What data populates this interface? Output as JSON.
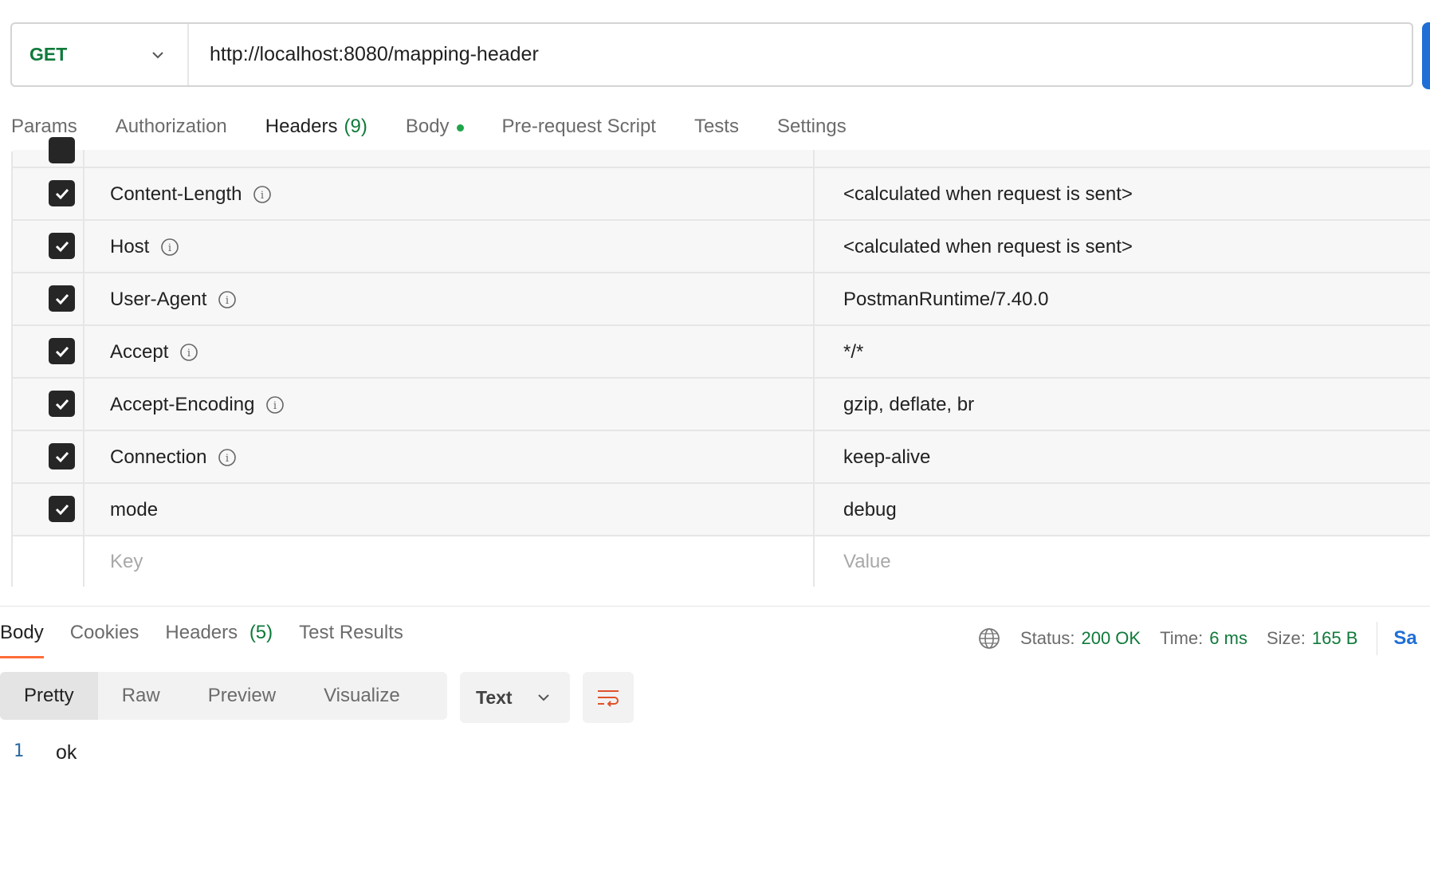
{
  "request": {
    "method": "GET",
    "url": "http://localhost:8080/mapping-header"
  },
  "request_tabs": [
    {
      "label": "Params"
    },
    {
      "label": "Authorization"
    },
    {
      "label": "Headers",
      "count": "(9)"
    },
    {
      "label": "Body"
    },
    {
      "label": "Pre-request Script"
    },
    {
      "label": "Tests"
    },
    {
      "label": "Settings"
    }
  ],
  "headers": [
    {
      "key": "Content-Length",
      "value": "<calculated when request is sent>",
      "checked": true
    },
    {
      "key": "Host",
      "value": "<calculated when request is sent>",
      "checked": true
    },
    {
      "key": "User-Agent",
      "value": "PostmanRuntime/7.40.0",
      "checked": true
    },
    {
      "key": "Accept",
      "value": "*/*",
      "checked": true
    },
    {
      "key": "Accept-Encoding",
      "value": "gzip, deflate, br",
      "checked": true
    },
    {
      "key": "Connection",
      "value": "keep-alive",
      "checked": true
    },
    {
      "key": "mode",
      "value": "debug",
      "checked": true
    }
  ],
  "new_header": {
    "key_placeholder": "Key",
    "value_placeholder": "Value"
  },
  "response_tabs": [
    {
      "label": "Body"
    },
    {
      "label": "Cookies"
    },
    {
      "label": "Headers",
      "count": "(5)"
    },
    {
      "label": "Test Results"
    }
  ],
  "response_meta": {
    "status_label": "Status:",
    "status_value": "200 OK",
    "time_label": "Time:",
    "time_value": "6 ms",
    "size_label": "Size:",
    "size_value": "165 B",
    "save_label": "Sa"
  },
  "view_modes": [
    "Pretty",
    "Raw",
    "Preview",
    "Visualize"
  ],
  "format": "Text",
  "response_body": [
    {
      "line": "1",
      "text": "ok"
    }
  ],
  "colors": {
    "accent": "#ff6c37",
    "success": "#0f7a3a",
    "link": "#1f6fd6"
  }
}
